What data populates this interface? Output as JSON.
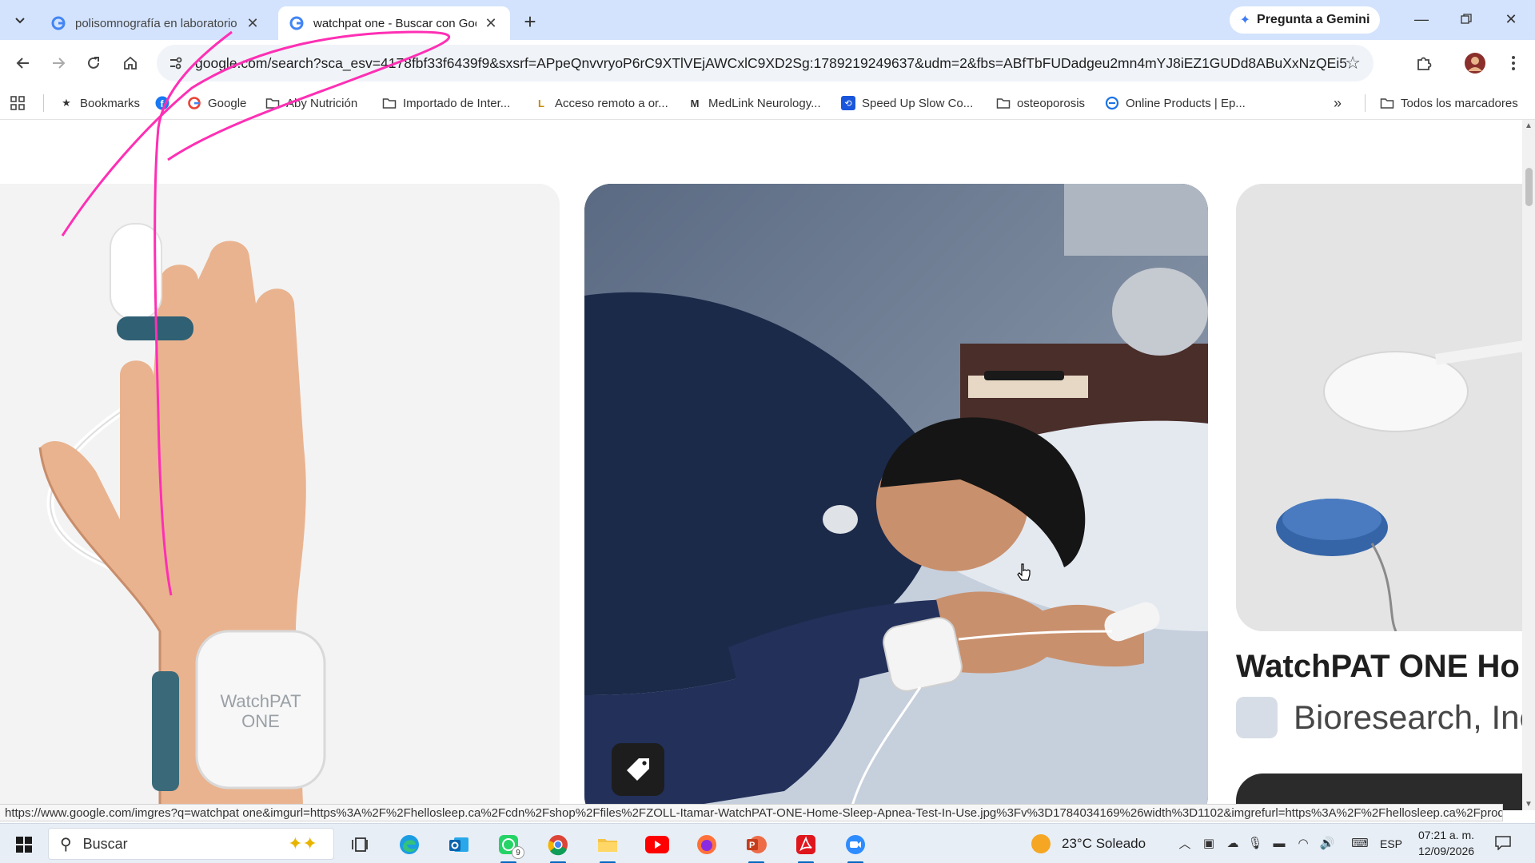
{
  "browser": {
    "tabs": [
      {
        "title": "polisomnografía en laboratorio",
        "active": false
      },
      {
        "title": "watchpat one - Buscar con Google",
        "active": true
      }
    ],
    "gemini_label": "Pregunta a Gemini",
    "url": "google.com/search?sca_esv=4178fbf33f6439f9&sxsrf=APpeQnvvryoP6rC9XTlVEjAWCxlC9XD2Sg:1789219249637&udm=2&fbs=ABfTbFUDadgeu2mn4mYJ8iEZ1GUDd8ABuXxNzQEi57SW...",
    "bookmarks": [
      {
        "label": "Bookmarks",
        "icon": "star-icon"
      },
      {
        "label": "",
        "icon": "facebook-icon"
      },
      {
        "label": "Google",
        "icon": "google-icon"
      },
      {
        "label": "Aby Nutrición",
        "icon": "folder-icon"
      },
      {
        "label": "Importado de Inter...",
        "icon": "folder-icon"
      },
      {
        "label": "Acceso remoto a or...",
        "icon": "site-icon"
      },
      {
        "label": "MedLink Neurology...",
        "icon": "site-icon"
      },
      {
        "label": "Speed Up Slow Co...",
        "icon": "site-icon"
      },
      {
        "label": "osteoporosis",
        "icon": "folder-icon"
      },
      {
        "label": "Online Products | Ep...",
        "icon": "site-icon"
      }
    ],
    "all_bookmarks_label": "Todos los marcadores",
    "status_url": "https://www.google.com/imgres?q=watchpat one&imgurl=https%3A%2F%2Fhellosleep.ca%2Fcdn%2Fshop%2Ffiles%2FZOLL-Itamar-WatchPAT-ONE-Home-Sleep-Apnea-Test-In-Use.jpg%3Fv%3D1784034169%26width%3D1102&imgrefurl=https%3A%2F%2Fhellosleep.ca%2Fprodu..."
  },
  "results": {
    "left_image_text": [
      "WatchPAT",
      "ONE"
    ],
    "right_title": "WatchPAT ONE Ho",
    "right_source": "Bioresearch, Inc"
  },
  "taskbar": {
    "search_placeholder": "Buscar",
    "whatsapp_badge": "9",
    "weather": "23°C  Soleado",
    "language": "ESP",
    "time": "07:21 a. m.",
    "date": "12/09/2026"
  },
  "colors": {
    "tabstrip": "#d3e3fd",
    "annotation_pen": "#ff2fb4",
    "google_blue": "#4285f4"
  }
}
